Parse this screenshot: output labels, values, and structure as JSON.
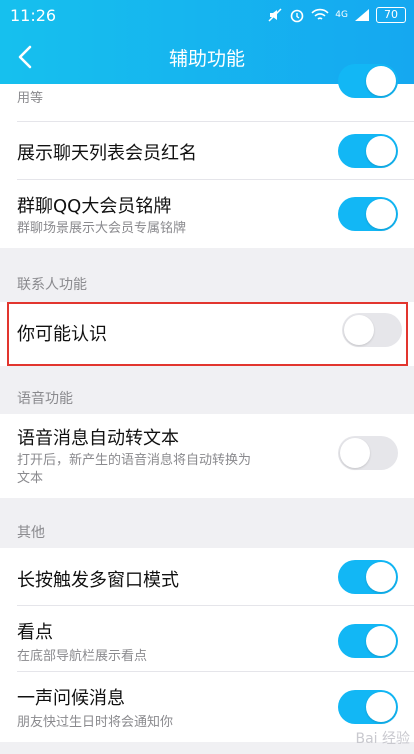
{
  "status_bar": {
    "time": "11:26",
    "signal_label": "4G",
    "battery": "70"
  },
  "nav": {
    "title": "辅助功能"
  },
  "partial_item": {
    "desc": "用等",
    "toggle_on": true
  },
  "items": [
    {
      "label": "展示聊天列表会员红名",
      "desc": "",
      "toggle_on": true
    },
    {
      "label": "群聊QQ大会员铭牌",
      "desc": "群聊场景展示大会员专属铭牌",
      "toggle_on": true
    }
  ],
  "sections": {
    "contacts": "联系人功能",
    "voice": "语音功能",
    "other": "其他"
  },
  "contacts_items": [
    {
      "label": "你可能认识",
      "toggle_on": false
    }
  ],
  "voice_items": [
    {
      "label": "语音消息自动转文本",
      "desc_line1": "打开后，新产生的语音消息将自动转换为",
      "desc_line2": "文本",
      "toggle_on": false
    }
  ],
  "other_items": [
    {
      "label": "长按触发多窗口模式",
      "desc": "",
      "toggle_on": true
    },
    {
      "label": "看点",
      "desc": "在底部导航栏展示看点",
      "toggle_on": true
    },
    {
      "label": "一声问候消息",
      "desc": "朋友快过生日时将会通知你",
      "toggle_on": true
    }
  ],
  "watermark": "Bai 经验",
  "colors": {
    "accent": "#12b7f5",
    "highlight_box": "#e2352e"
  }
}
